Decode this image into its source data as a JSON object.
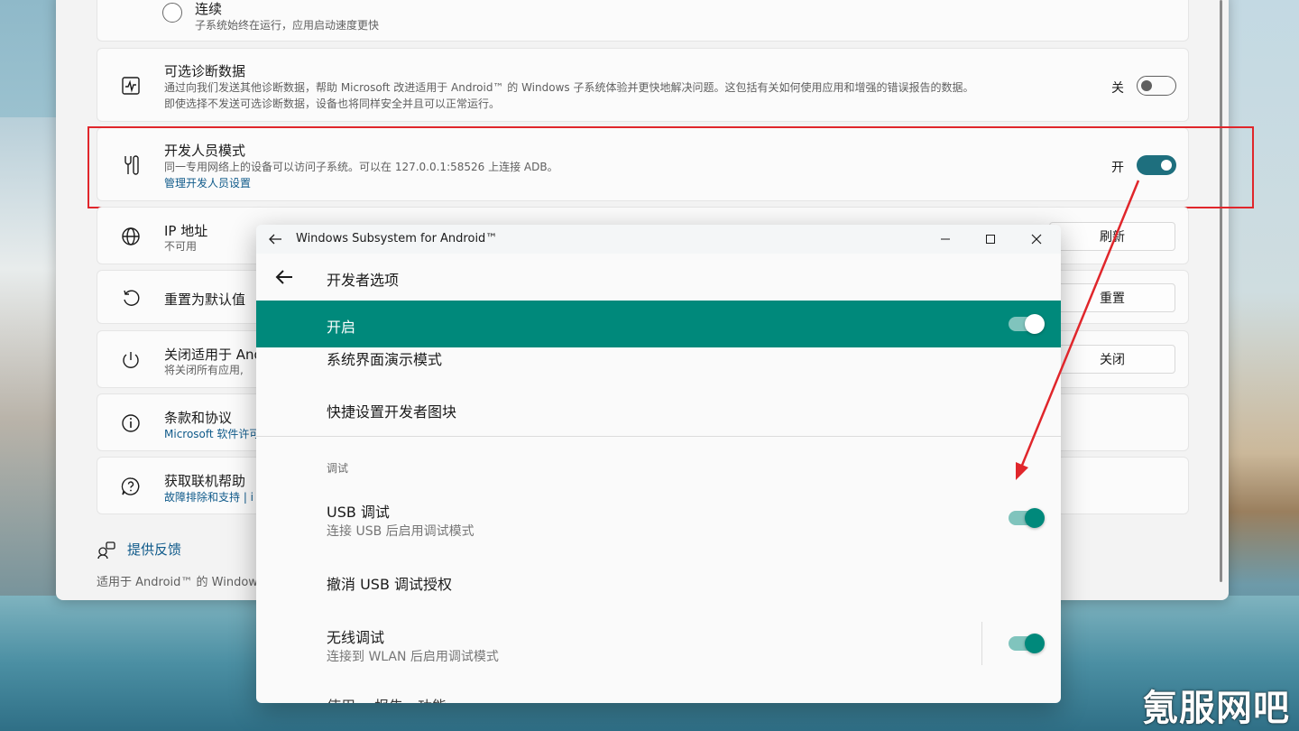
{
  "settings": {
    "continuous": {
      "title": "连续",
      "desc": "子系统始终在运行，应用启动速度更快"
    },
    "diagnostics": {
      "title": "可选诊断数据",
      "desc1": "通过向我们发送其他诊断数据，帮助 Microsoft 改进适用于 Android™ 的 Windows 子系统体验并更快地解决问题。这包括有关如何使用应用和增强的错误报告的数据。",
      "desc2": "即使选择不发送可选诊断数据，设备也将同样安全并且可以正常运行。",
      "state_label": "关",
      "state": false
    },
    "developer_mode": {
      "title": "开发人员模式",
      "desc": "同一专用网络上的设备可以访问子系统。可以在 127.0.0.1:58526 上连接 ADB。",
      "link": "管理开发人员设置",
      "state_label": "开",
      "state": true
    },
    "ip": {
      "title": "IP 地址",
      "desc": "不可用",
      "button": "刷新"
    },
    "reset": {
      "title": "重置为默认值",
      "button": "重置"
    },
    "shutdown": {
      "title": "关闭适用于 And",
      "desc": "将关闭所有应用,",
      "button": "关闭"
    },
    "terms": {
      "title": "条款和协议",
      "link": "Microsoft 软件许可"
    },
    "help": {
      "title": "获取联机帮助",
      "link": "故障排除和支持 | i"
    },
    "feedback": "提供反馈",
    "footer": "适用于 Android™ 的 Windows"
  },
  "wsa": {
    "window_title": "Windows Subsystem for Android™",
    "header_title": "开发者选项",
    "master": {
      "label": "开启",
      "state": true
    },
    "rows": {
      "demo_mode": "系统界面演示模式",
      "quick_tiles": "快捷设置开发者图块",
      "section_debug": "调试",
      "usb_debug": {
        "title": "USB 调试",
        "sub": "连接 USB 后启用调试模式",
        "state": true
      },
      "revoke_usb": "撤消 USB 调试授权",
      "wireless_debug": {
        "title": "无线调试",
        "sub": "连接到 WLAN 后启用调试模式",
        "state": true
      },
      "partial": "使用…    报告…功能"
    }
  },
  "watermark": "氪服网吧",
  "colors": {
    "accent_win": "#1e6f7e",
    "accent_android": "#00897b",
    "highlight": "#e0262b",
    "link": "#0f5a8a"
  }
}
